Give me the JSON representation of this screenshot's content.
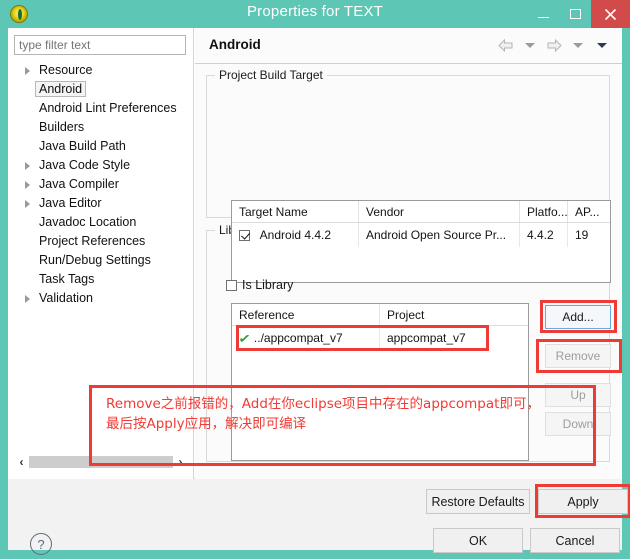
{
  "window": {
    "title": "Properties for TEXT",
    "app_icon": "eclipse-icon",
    "minimize_label": "–",
    "maximize_label": "□",
    "close_label": "×",
    "titlebar_color": "#5ec6b4",
    "close_color": "#d14b4b"
  },
  "sidebar": {
    "filter": {
      "placeholder": "type filter text",
      "value": ""
    },
    "items": [
      {
        "label": "Resource",
        "expandable": true,
        "selected": false
      },
      {
        "label": "Android",
        "expandable": false,
        "selected": true
      },
      {
        "label": "Android Lint Preferences",
        "expandable": false,
        "selected": false
      },
      {
        "label": "Builders",
        "expandable": false,
        "selected": false
      },
      {
        "label": "Java Build Path",
        "expandable": false,
        "selected": false
      },
      {
        "label": "Java Code Style",
        "expandable": true,
        "selected": false
      },
      {
        "label": "Java Compiler",
        "expandable": true,
        "selected": false
      },
      {
        "label": "Java Editor",
        "expandable": true,
        "selected": false
      },
      {
        "label": "Javadoc Location",
        "expandable": false,
        "selected": false
      },
      {
        "label": "Project References",
        "expandable": false,
        "selected": false
      },
      {
        "label": "Run/Debug Settings",
        "expandable": false,
        "selected": false
      },
      {
        "label": "Task Tags",
        "expandable": false,
        "selected": false
      },
      {
        "label": "Validation",
        "expandable": true,
        "selected": false
      }
    ],
    "scroll_left_label": "‹",
    "scroll_right_label": "›"
  },
  "page": {
    "title": "Android",
    "nav": {
      "back_icon": "back-arrow-icon",
      "back_menu_icon": "chevron-down-icon",
      "forward_icon": "forward-arrow-icon",
      "forward_menu_icon": "chevron-down-icon",
      "view_menu_icon": "chevron-down-icon"
    }
  },
  "build_target": {
    "legend": "Project Build Target",
    "columns": [
      "Target Name",
      "Vendor",
      "Platfo...",
      "AP..."
    ],
    "rows": [
      {
        "checked": true,
        "target_name": "Android 4.4.2",
        "vendor": "Android Open Source Pr...",
        "platform": "4.4.2",
        "api": "19"
      }
    ]
  },
  "library": {
    "legend": "Library",
    "is_library": {
      "label": "Is Library",
      "checked": false
    },
    "columns": [
      "Reference",
      "Project"
    ],
    "rows": [
      {
        "status_icon": "green-check-icon",
        "reference": "../appcompat_v7",
        "project": "appcompat_v7"
      }
    ],
    "buttons": [
      {
        "id": "add",
        "label": "Add...",
        "enabled": true,
        "focused": true
      },
      {
        "id": "remove",
        "label": "Remove",
        "enabled": false,
        "focused": false
      },
      {
        "id": "up",
        "label": "Up",
        "enabled": false,
        "focused": false
      },
      {
        "id": "down",
        "label": "Down",
        "enabled": false,
        "focused": false
      }
    ]
  },
  "footer": {
    "restore_defaults": "Restore Defaults",
    "apply": "Apply",
    "ok": "OK",
    "cancel": "Cancel",
    "help_icon": "question-mark-icon",
    "help_label": "?"
  },
  "annotation": {
    "color": "#ef3b35",
    "note": "Remove之前报错的，Add在你eclipse项目中存在的appcompat即可，\n最后按Apply应用，解决即可编译",
    "highlighted": [
      "add-button",
      "remove-button",
      "library-row",
      "note-area",
      "apply-button"
    ]
  }
}
